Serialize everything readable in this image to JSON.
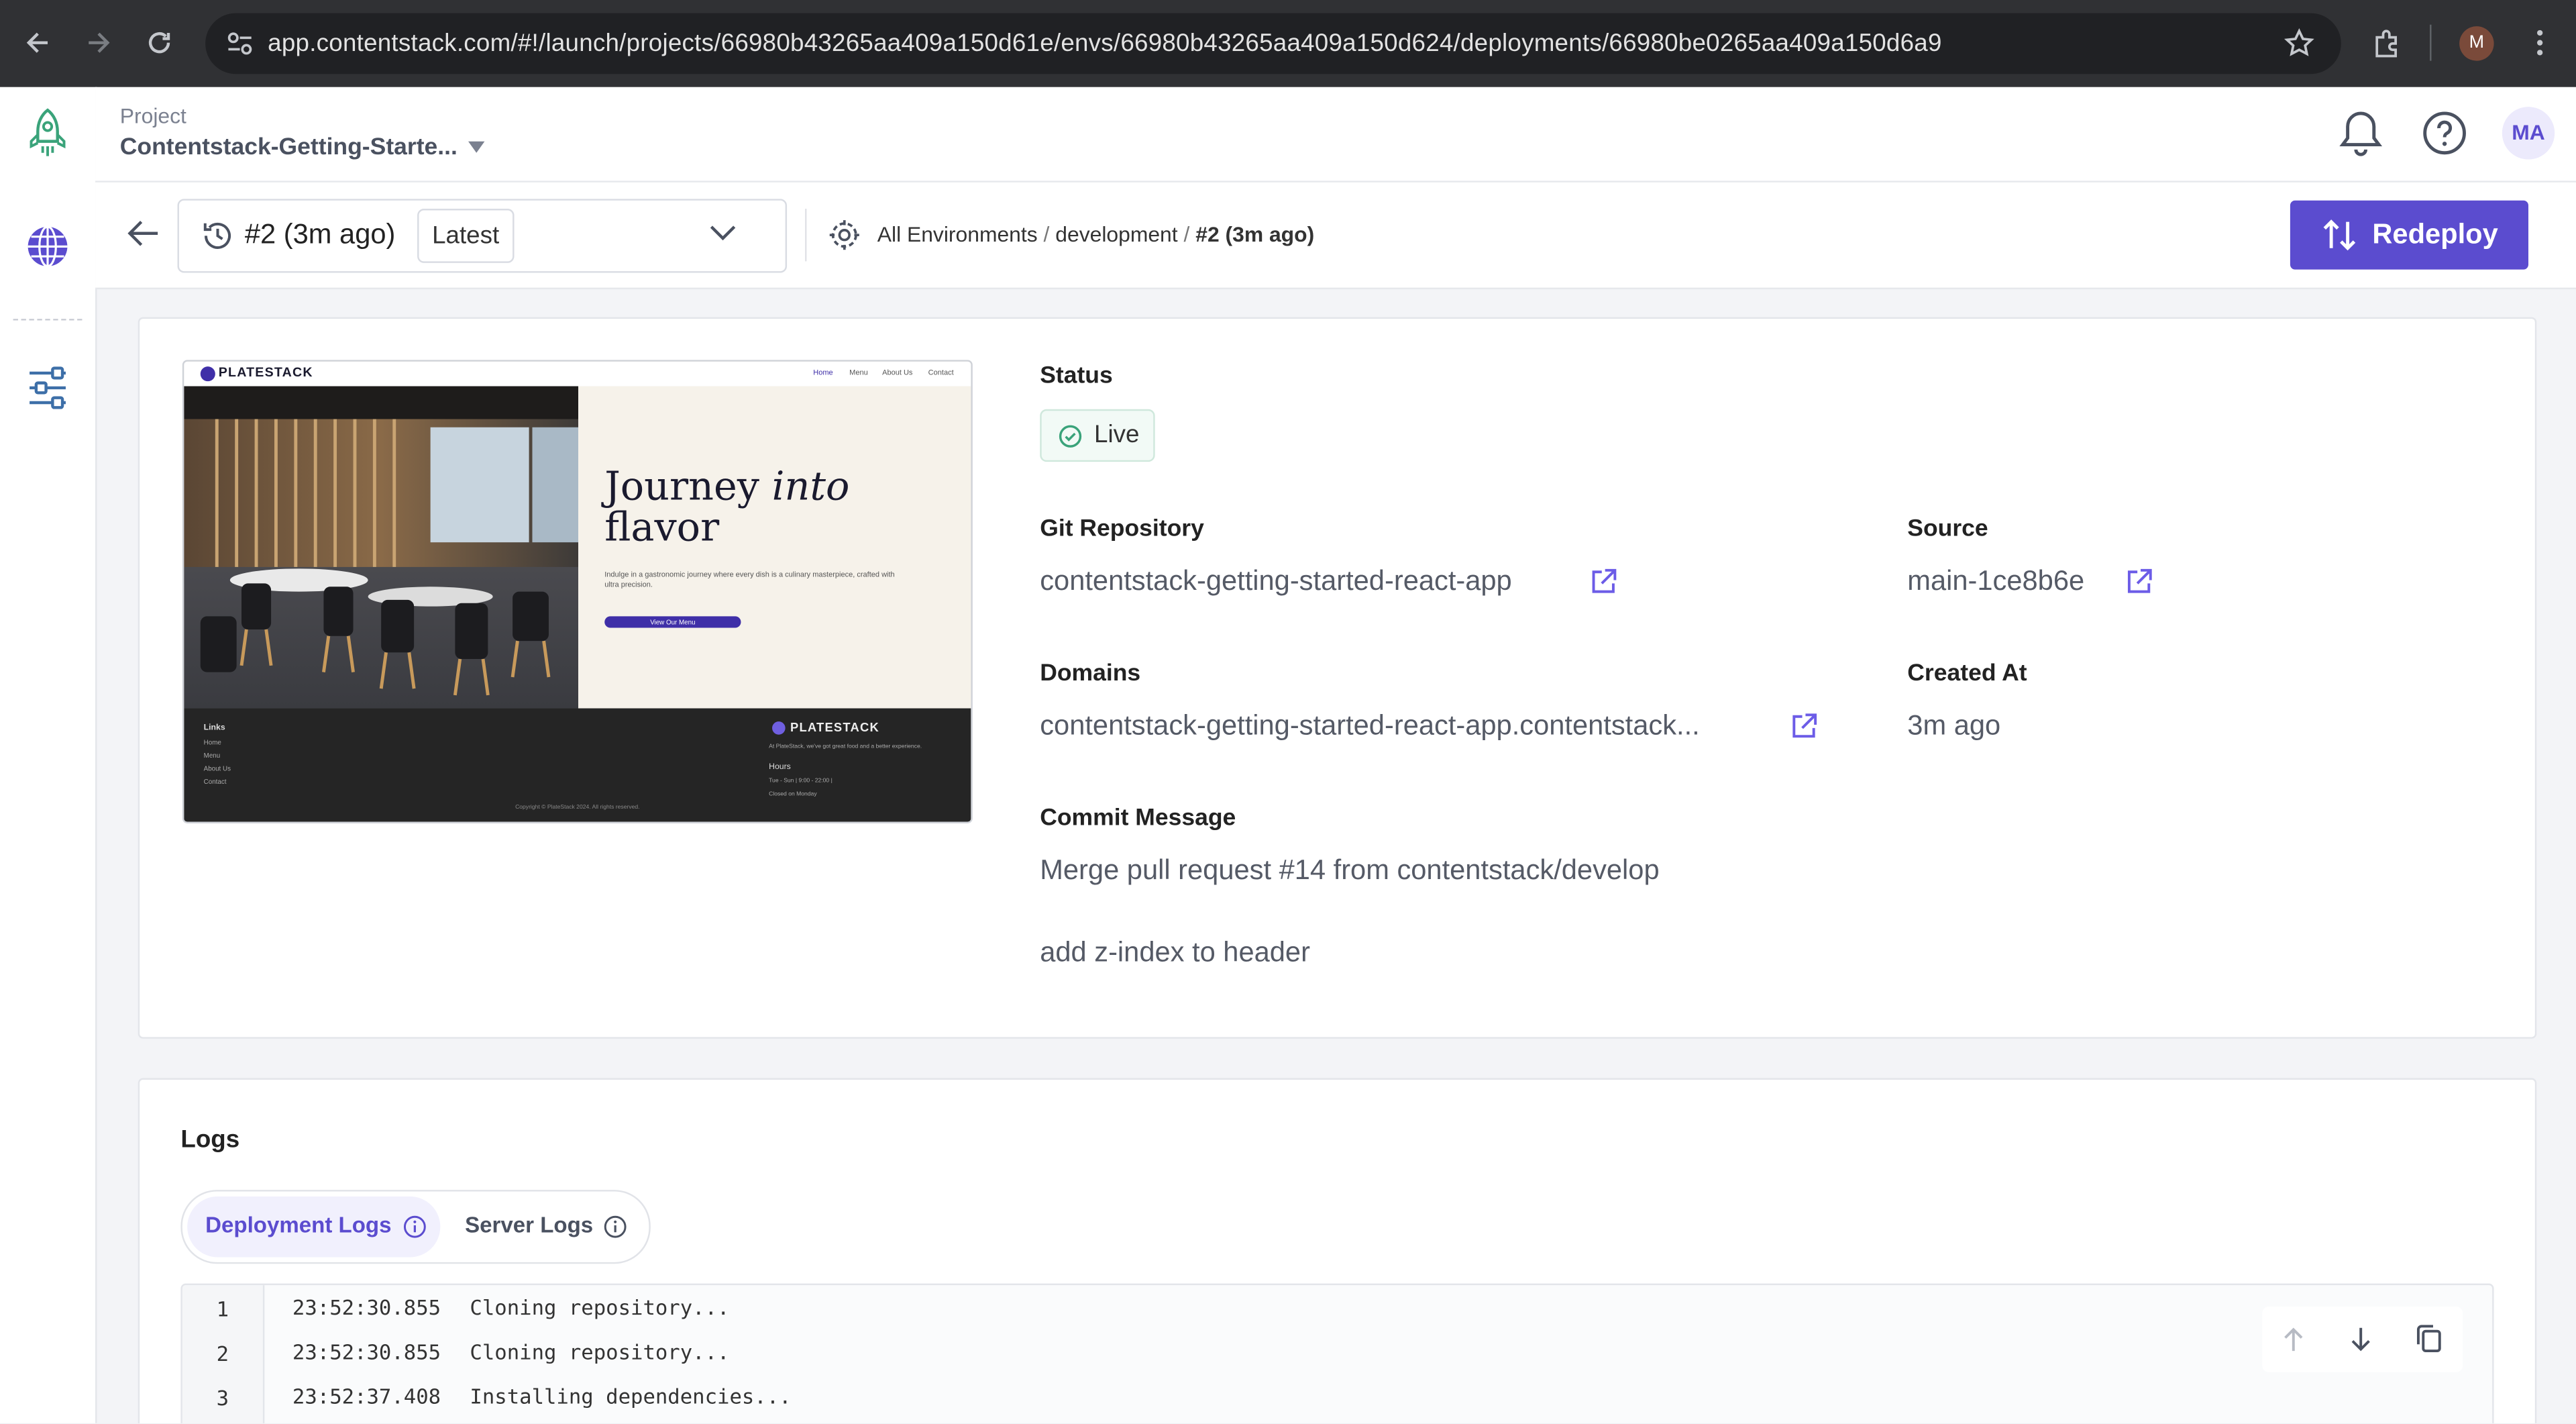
{
  "browser": {
    "url": "app.contentstack.com/#!/launch/projects/66980b43265aa409a150d61e/envs/66980b43265aa409a150d624/deployments/66980be0265aa409a150d6a9",
    "profile_initial": "M"
  },
  "header": {
    "project_caption": "Project",
    "project_name": "Contentstack-Getting-Starte...",
    "user_initials": "MA"
  },
  "subbar": {
    "deployment_label": "#2 (3m ago)",
    "latest_badge": "Latest",
    "breadcrumb": {
      "root": "All Environments",
      "sep1": "/",
      "env": "development",
      "sep2": "/",
      "current": "#2 (3m ago)"
    },
    "redeploy_label": "Redeploy"
  },
  "preview": {
    "logo": "PLATESTACK",
    "nav": [
      "Home",
      "Menu",
      "About Us",
      "Contact"
    ],
    "headline_line1": "Journey ",
    "headline_italic": "into",
    "headline_line2": "flavor",
    "tagline": "Indulge in a gastronomic journey where every dish is a culinary masterpiece, crafted with ultra precision.",
    "cta": "View Our Menu",
    "footer_links_title": "Links",
    "footer_links": [
      "Home",
      "Menu",
      "About Us",
      "Contact"
    ],
    "footer_logo": "PLATESTACK",
    "footer_blurb": "At PlateStack, we've got great food and a better experience.",
    "footer_hours_title": "Hours",
    "footer_hours": [
      "Tue - Sun | 9:00 - 22:00 |",
      "Closed on Monday"
    ],
    "copyright": "Copyright © PlateStack 2024. All rights reserved."
  },
  "details": {
    "status_label": "Status",
    "status_value": "Live",
    "git_label": "Git Repository",
    "git_value": "contentstack-getting-started-react-app",
    "source_label": "Source",
    "source_value": "main-1ce8b6e",
    "domains_label": "Domains",
    "domains_value": "contentstack-getting-started-react-app.contentstack...",
    "created_label": "Created At",
    "created_value": "3m ago",
    "commit_label": "Commit Message",
    "commit_line1": "Merge pull request #14 from contentstack/develop",
    "commit_line2": "add z-index to header"
  },
  "logs": {
    "title": "Logs",
    "tabs": [
      "Deployment Logs",
      "Server Logs"
    ],
    "lines": [
      {
        "num": "1",
        "time": "23:52:30.855",
        "text": "Cloning repository..."
      },
      {
        "num": "2",
        "time": "23:52:30.855",
        "text": "Cloning repository..."
      },
      {
        "num": "3",
        "time": "23:52:37.408",
        "text": "Installing dependencies..."
      }
    ]
  },
  "colors": {
    "accent": "#6c5ce7",
    "accent_dark": "#5b4ccf",
    "live_green": "#3aa37a"
  }
}
